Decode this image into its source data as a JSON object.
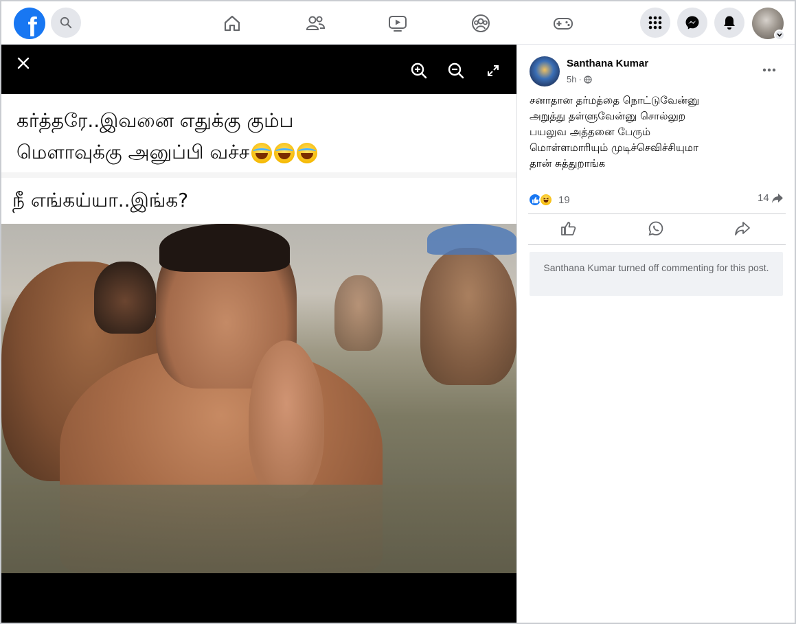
{
  "nav": {
    "logo_letter": "f",
    "search_icon": "search-icon",
    "center_icons": [
      "home-icon",
      "friends-icon",
      "watch-icon",
      "groups-icon",
      "gaming-icon"
    ],
    "right_icons": [
      "menu-grid-icon",
      "messenger-icon",
      "notifications-bell-icon",
      "account-avatar"
    ]
  },
  "viewer": {
    "close_icon": "close-icon",
    "zoom_in_icon": "zoom-in-icon",
    "zoom_out_icon": "zoom-out-icon",
    "fullscreen_icon": "fullscreen-icon",
    "meme": {
      "line1": "கர்த்தரே..இவனை எதுக்கு கும்ப",
      "line2": "மௌாவுக்கு அனுப்பி வச்ச",
      "line3": "நீ எங்கய்யா..இங்க?"
    }
  },
  "post": {
    "author": "Santhana Kumar",
    "time": "5h",
    "audience_icon": "globe-icon",
    "more_icon": "more-options-icon",
    "text": "சனாதான தர்மத்தை நொட்டுவேன்னு\nஅறுத்து தள்ளுவேன்னு சொல்லுற\nபயலுவ அத்தனை பேரும்\nமொள்ளமாரியும் முடிச்செவிச்சியுமா\nதான் சுத்துறாங்க",
    "reaction_count": "19",
    "share_count": "14",
    "actions": [
      "like-icon",
      "whatsapp-icon",
      "share-icon"
    ],
    "comment_notice": "Santhana Kumar turned off commenting for this post."
  },
  "colors": {
    "brand_blue": "#1877f2",
    "icon_gray": "#65676b",
    "notice_bg": "#f0f2f5"
  }
}
